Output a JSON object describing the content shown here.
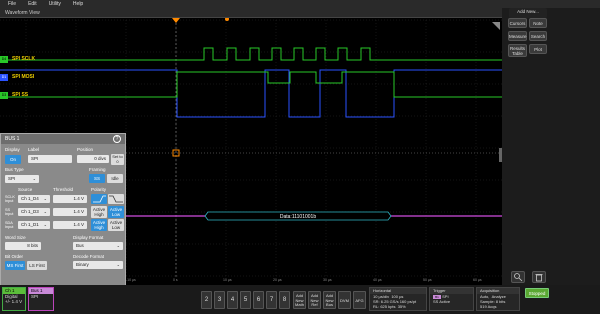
{
  "menu": [
    "File",
    "Edit",
    "Utility",
    "Help"
  ],
  "view_title": "Waveform View",
  "channels": [
    {
      "label": "SPI SCLK",
      "tag": "D4"
    },
    {
      "label": "SPI MOSI",
      "tag": "D1"
    },
    {
      "label": "SPI SS",
      "tag": "D3"
    }
  ],
  "bus_decode": "Data:11101001b",
  "time_ticks": [
    "-10 µs",
    "0 s",
    "10 µs",
    "20 µs",
    "30 µs",
    "40 µs",
    "50 µs",
    "60 µs"
  ],
  "right_panel": {
    "add_new": "Add New...",
    "cursors": "Cursors",
    "note": "Note",
    "measure": "Measure",
    "search": "Search",
    "results_table": "Results Table",
    "plot": "Plot"
  },
  "dialog": {
    "title": "BUS 1",
    "display_label": "Display",
    "display_on": "On",
    "label_label": "Label",
    "label_value": "SPI",
    "position_label": "Position",
    "position_value": "0 divs",
    "set_to_zero": "Set to 0",
    "bus_type_label": "Bus Type",
    "bus_type_value": "SPI",
    "framing_label": "Framing",
    "framing_ss": "SS",
    "framing_idle": "Idle",
    "source_label": "Source",
    "threshold_label": "Threshold",
    "polarity_label": "Polarity",
    "rows": [
      {
        "name": "SCLK Input",
        "source": "Ch 1_D4",
        "threshold": "1.4 V"
      },
      {
        "name": "SS Input",
        "source": "Ch 1_D3",
        "threshold": "1.4 V",
        "active_high": "Active High",
        "active_low": "Active Low"
      },
      {
        "name": "SDA Input",
        "source": "Ch 1_D1",
        "threshold": "1.4 V",
        "active_high": "Active High",
        "active_low": "Active Low"
      }
    ],
    "word_size_label": "Word Size",
    "word_size_value": "8 bits",
    "display_format_label": "Display Format",
    "display_format_value": "Bus",
    "bit_order_label": "Bit Order",
    "ms_first": "MS First",
    "ls_first": "LS First",
    "decode_format_label": "Decode Format",
    "decode_format_value": "Binary"
  },
  "bottom": {
    "ch1_title": "Ch 1",
    "ch1_line1": "Digital",
    "ch1_line2": "+/- 1.4 V",
    "bus_title": "Bus 1",
    "bus_value": "SPI",
    "nums": [
      "2",
      "3",
      "4",
      "5",
      "6",
      "7",
      "8"
    ],
    "add_math": "Add New Math",
    "add_ref": "Add New Ref",
    "add_bus": "Add New Bus",
    "dvm": "DVM",
    "afg": "AFG",
    "horizontal": {
      "title": "Horizontal",
      "r1": "10 µs/div",
      "r1b": "100 µs",
      "r2": "SR: 6.25 GS/s",
      "r2b": "160 ps/pt",
      "r3": "RL: 625 kpts",
      "r3b": "35%"
    },
    "trigger": {
      "title": "Trigger",
      "r1": "SPI",
      "r2": "SS Active"
    },
    "acquisition": {
      "title": "Acquisition",
      "r1": "Auto,",
      "r1b": "Analyze",
      "r2": "Sample: 8 bits",
      "r3": "519 Acqs"
    },
    "stopped": "Stopped"
  },
  "colors": {
    "sclk": "#28c828",
    "mosi": "#2a52ff",
    "ss": "#28c828",
    "bus": "#d04ce0",
    "accent": "#2e8fd8"
  }
}
